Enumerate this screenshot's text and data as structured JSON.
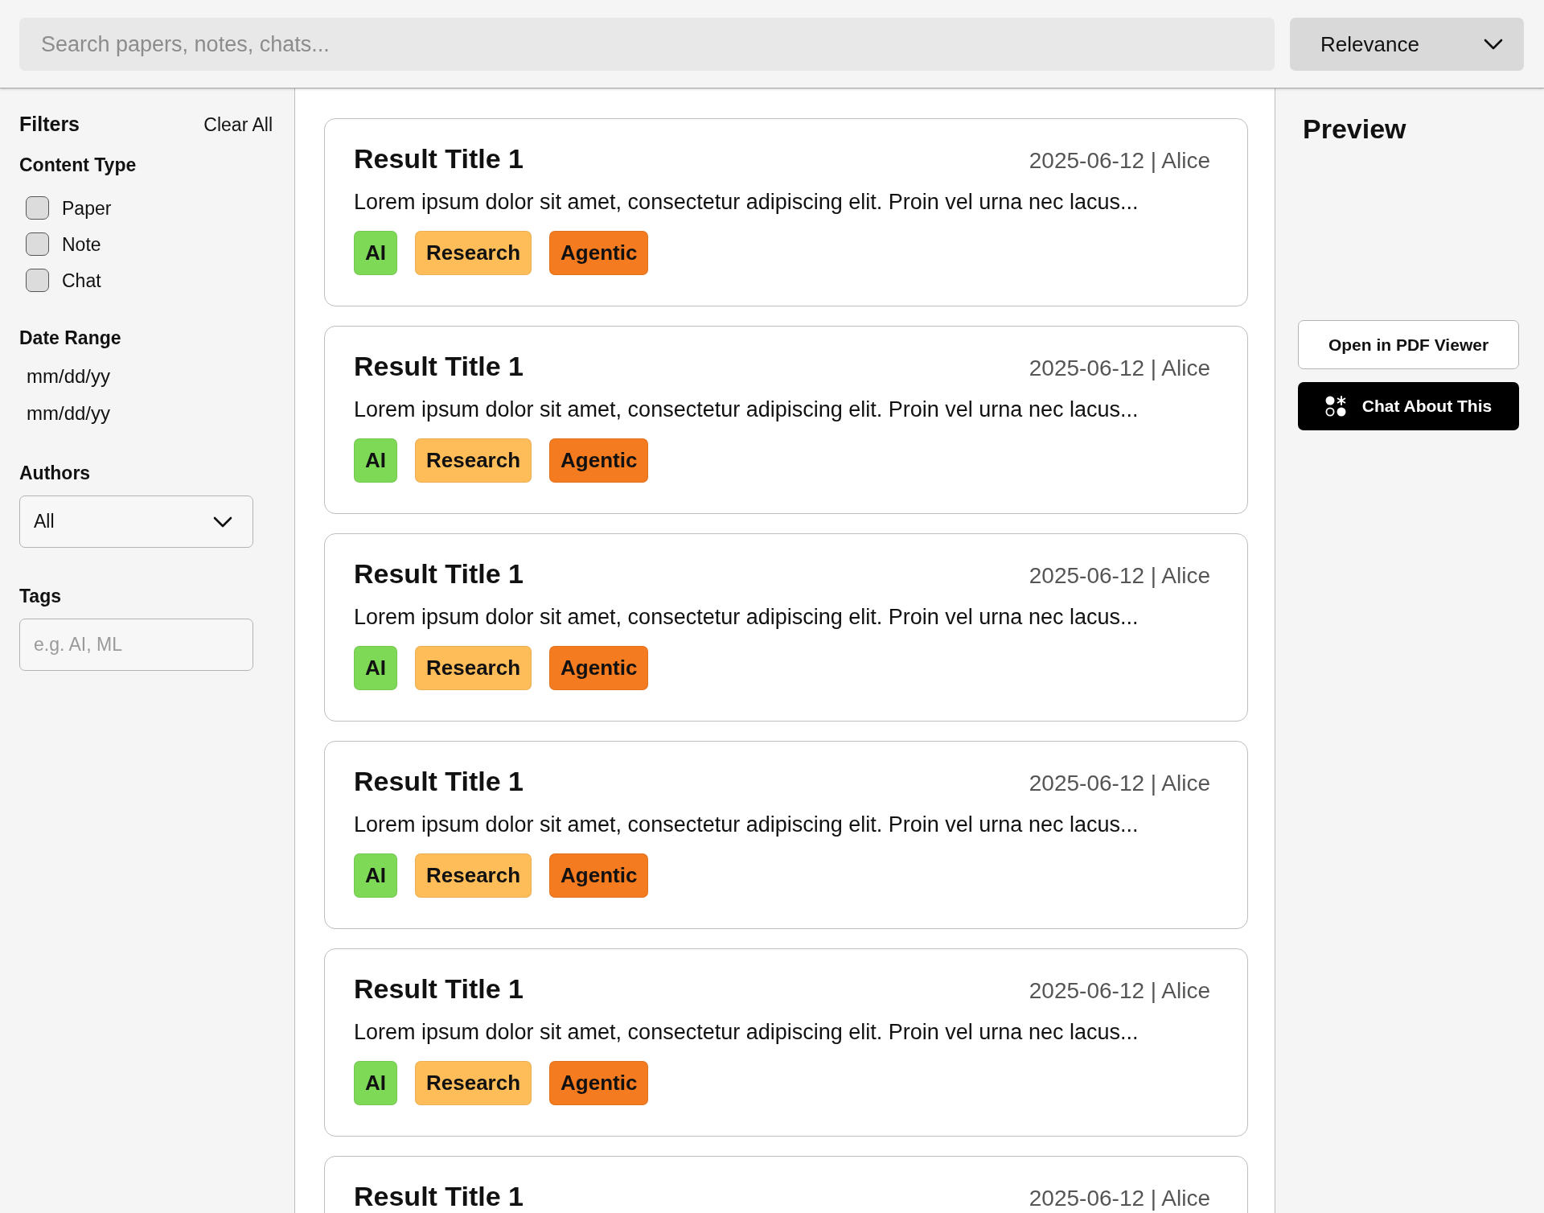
{
  "search": {
    "placeholder": "Search papers, notes, chats..."
  },
  "sort": {
    "value": "Relevance"
  },
  "filters": {
    "title": "Filters",
    "clear_label": "Clear All",
    "content_type": {
      "label": "Content Type",
      "options": [
        {
          "label": "Paper",
          "checked": false
        },
        {
          "label": "Note",
          "checked": false
        },
        {
          "label": "Chat",
          "checked": false
        }
      ]
    },
    "date_range": {
      "label": "Date Range",
      "fields": [
        {
          "placeholder": "mm/dd/yy"
        },
        {
          "placeholder": "mm/dd/yy"
        }
      ]
    },
    "authors": {
      "label": "Authors",
      "value": "All"
    },
    "tags": {
      "label": "Tags",
      "placeholder": "e.g. AI, ML"
    }
  },
  "results": [
    {
      "title": "Result Title 1",
      "meta": "2025-06-12 | Alice",
      "snippet": "Lorem ipsum dolor sit amet, consectetur adipiscing elit. Proin vel urna nec lacus...",
      "tags": [
        {
          "label": "AI",
          "color": "#7ed957"
        },
        {
          "label": "Research",
          "color": "#ffbd59"
        },
        {
          "label": "Agentic",
          "color": "#f47b20"
        }
      ]
    },
    {
      "title": "Result Title 1",
      "meta": "2025-06-12 | Alice",
      "snippet": "Lorem ipsum dolor sit amet, consectetur adipiscing elit. Proin vel urna nec lacus...",
      "tags": [
        {
          "label": "AI",
          "color": "#7ed957"
        },
        {
          "label": "Research",
          "color": "#ffbd59"
        },
        {
          "label": "Agentic",
          "color": "#f47b20"
        }
      ]
    },
    {
      "title": "Result Title 1",
      "meta": "2025-06-12 | Alice",
      "snippet": "Lorem ipsum dolor sit amet, consectetur adipiscing elit. Proin vel urna nec lacus...",
      "tags": [
        {
          "label": "AI",
          "color": "#7ed957"
        },
        {
          "label": "Research",
          "color": "#ffbd59"
        },
        {
          "label": "Agentic",
          "color": "#f47b20"
        }
      ]
    },
    {
      "title": "Result Title 1",
      "meta": "2025-06-12 | Alice",
      "snippet": "Lorem ipsum dolor sit amet, consectetur adipiscing elit. Proin vel urna nec lacus...",
      "tags": [
        {
          "label": "AI",
          "color": "#7ed957"
        },
        {
          "label": "Research",
          "color": "#ffbd59"
        },
        {
          "label": "Agentic",
          "color": "#f47b20"
        }
      ]
    },
    {
      "title": "Result Title 1",
      "meta": "2025-06-12 | Alice",
      "snippet": "Lorem ipsum dolor sit amet, consectetur adipiscing elit. Proin vel urna nec lacus...",
      "tags": [
        {
          "label": "AI",
          "color": "#7ed957"
        },
        {
          "label": "Research",
          "color": "#ffbd59"
        },
        {
          "label": "Agentic",
          "color": "#f47b20"
        }
      ]
    },
    {
      "title": "Result Title 1",
      "meta": "2025-06-12 | Alice"
    }
  ],
  "preview": {
    "title": "Preview",
    "buttons": [
      {
        "label": "Open in PDF Viewer",
        "kind": "outline"
      },
      {
        "label": "Chat About This",
        "kind": "primary"
      }
    ]
  }
}
